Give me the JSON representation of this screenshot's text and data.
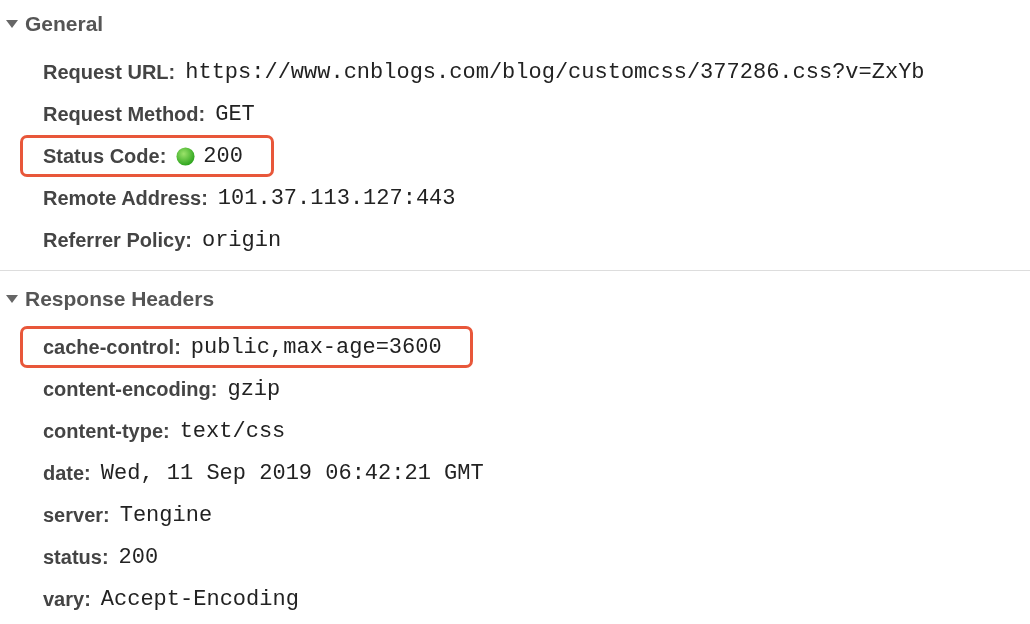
{
  "sections": [
    {
      "title": "General",
      "expanded": true,
      "rows": [
        {
          "key": "Request URL:",
          "value": "https://www.cnblogs.com/blog/customcss/377286.css?v=ZxYb",
          "highlighted": false
        },
        {
          "key": "Request Method:",
          "value": "GET",
          "highlighted": false
        },
        {
          "key": "Status Code:",
          "value": "200",
          "highlighted": true,
          "kind": "status"
        },
        {
          "key": "Remote Address:",
          "value": "101.37.113.127:443",
          "highlighted": false
        },
        {
          "key": "Referrer Policy:",
          "value": "origin",
          "highlighted": false
        }
      ]
    },
    {
      "title": "Response Headers",
      "expanded": true,
      "rows": [
        {
          "key": "cache-control:",
          "value": "public,max-age=3600",
          "highlighted": true
        },
        {
          "key": "content-encoding:",
          "value": "gzip",
          "highlighted": false
        },
        {
          "key": "content-type:",
          "value": "text/css",
          "highlighted": false
        },
        {
          "key": "date:",
          "value": "Wed, 11 Sep 2019 06:42:21 GMT",
          "highlighted": false
        },
        {
          "key": "server:",
          "value": "Tengine",
          "highlighted": false
        },
        {
          "key": "status:",
          "value": "200",
          "highlighted": false
        },
        {
          "key": "vary:",
          "value": "Accept-Encoding",
          "highlighted": false
        }
      ]
    }
  ]
}
